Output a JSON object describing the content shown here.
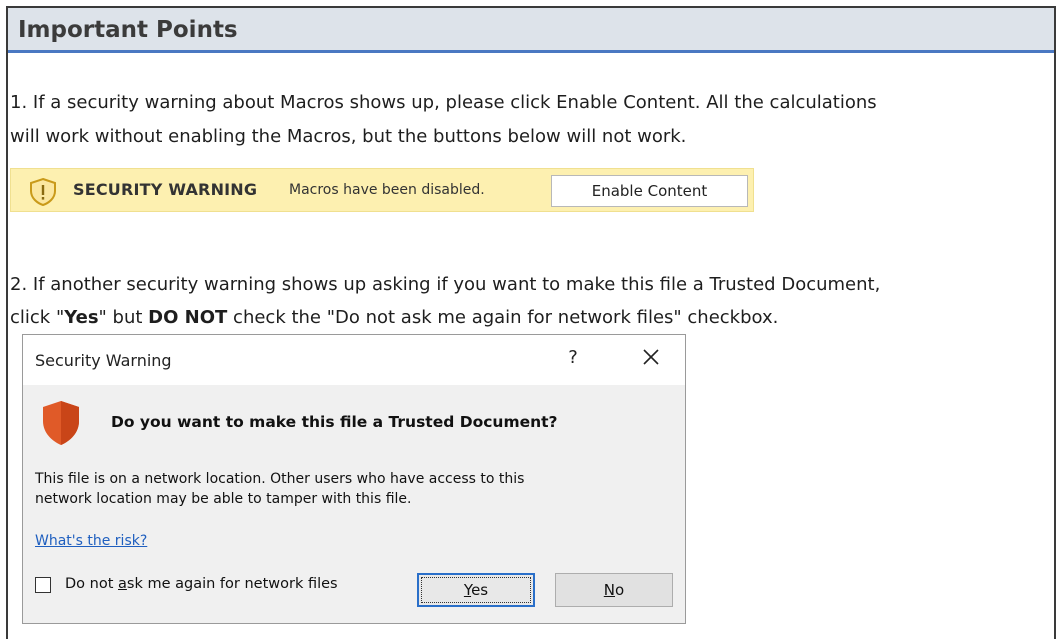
{
  "header": {
    "title": "Important Points"
  },
  "point1": {
    "line1": "1. If a security warning about Macros shows up, please click Enable Content. All the calculations",
    "line2": "will work without enabling the Macros, but the buttons below will not work."
  },
  "security_bar": {
    "title": "SECURITY WARNING",
    "message": "Macros have been disabled.",
    "button_label": "Enable Content",
    "icon": "shield-warning-icon",
    "background_color": "#fdf0b0"
  },
  "point2": {
    "line1": "2. If another security warning shows up asking if you want to make this file a Trusted Document,",
    "line2_pre": "click \"",
    "line2_yes": "Yes",
    "line2_mid": "\" but ",
    "line2_donot": "DO NOT",
    "line2_post": " check the \"Do not ask me again for network files\" checkbox."
  },
  "dialog": {
    "title": "Security Warning",
    "help_label": "?",
    "question": "Do you want to make this file a Trusted Document?",
    "body_line1": "This file is on a network location. Other users who have access to this",
    "body_line2": "network location may be able to tamper with this file.",
    "risk_link": "What's the risk?",
    "checkbox_label_pre": "Do not ",
    "checkbox_label_accel": "a",
    "checkbox_label_post": "sk me again for network files",
    "checkbox_checked": false,
    "yes_accel": "Y",
    "yes_rest": "es",
    "no_accel": "N",
    "no_rest": "o",
    "shield_color": "#e05a28"
  },
  "colors": {
    "header_bg": "#dde3ea",
    "header_rule": "#4a78c2",
    "link": "#1f5fbf"
  }
}
